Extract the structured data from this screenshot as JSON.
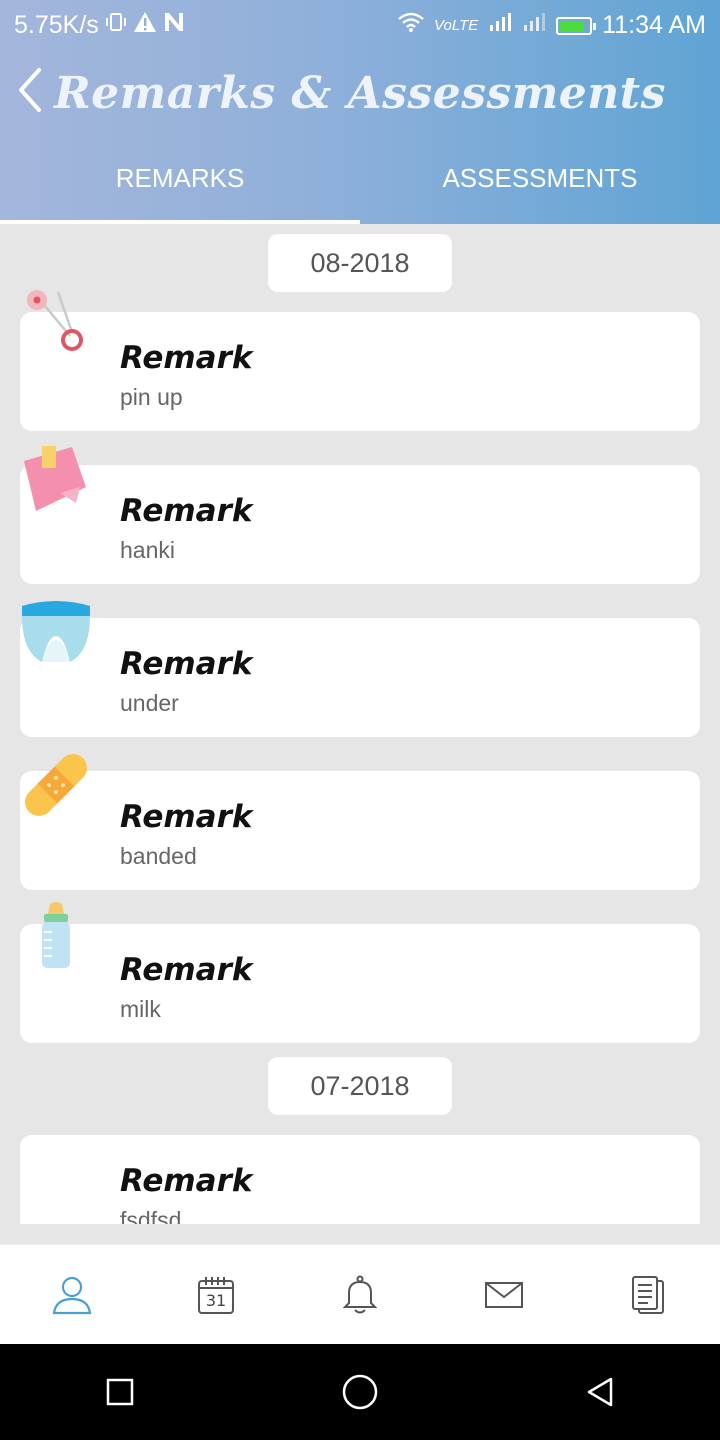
{
  "status_bar": {
    "network_speed": "5.75K/s",
    "volte": "VoLTE",
    "time": "11:34 AM",
    "battery_color": "#4cdc3c"
  },
  "app_bar": {
    "title": "Remarks & Assessments",
    "back_icon": "chevron-left-icon"
  },
  "tabs": [
    {
      "label": "REMARKS",
      "active": true
    },
    {
      "label": "ASSESSMENTS",
      "active": false
    }
  ],
  "groups": [
    {
      "date": "08-2018",
      "items": [
        {
          "title": "Remark",
          "subtitle": "pin up",
          "icon": "safety-pin-icon"
        },
        {
          "title": "Remark",
          "subtitle": "hanki",
          "icon": "handkerchief-icon"
        },
        {
          "title": "Remark",
          "subtitle": "under",
          "icon": "diaper-icon"
        },
        {
          "title": "Remark",
          "subtitle": "banded",
          "icon": "bandage-icon"
        },
        {
          "title": "Remark",
          "subtitle": "milk",
          "icon": "baby-bottle-icon"
        }
      ]
    },
    {
      "date": "07-2018",
      "items": [
        {
          "title": "Remark",
          "subtitle": "fsdfsd",
          "icon": ""
        }
      ]
    }
  ],
  "bottom_nav": [
    {
      "icon": "profile-icon",
      "active": true
    },
    {
      "icon": "calendar-icon",
      "label": "31",
      "active": false
    },
    {
      "icon": "bell-icon",
      "active": false
    },
    {
      "icon": "mail-icon",
      "active": false
    },
    {
      "icon": "documents-icon",
      "active": false
    }
  ],
  "colors": {
    "header_left": "#a4b6dc",
    "header_right": "#5fa4d4",
    "active_nav": "#4a9fd6",
    "content_bg": "#e6e6e6"
  }
}
